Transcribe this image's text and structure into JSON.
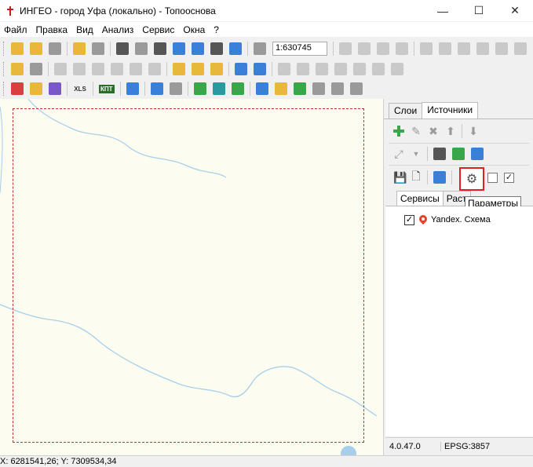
{
  "window": {
    "title": "ИНГЕО - город Уфа (локально) - Топооснова",
    "minimize_glyph": "—",
    "maximize_glyph": "☐",
    "close_glyph": "✕"
  },
  "menu": {
    "items": [
      "Файл",
      "Правка",
      "Вид",
      "Анализ",
      "Сервис",
      "Окна",
      "?"
    ]
  },
  "toolbar": {
    "scale_value": "1:630745",
    "xls_label": "XLS",
    "kpt_label": "КПТ"
  },
  "panel": {
    "tabs": [
      "Слои",
      "Источники"
    ],
    "active_tab": "Источники",
    "subtabs": [
      "Сервисы",
      "Раст"
    ],
    "active_subtab": "Сервисы",
    "tooltip": "Параметры",
    "list": [
      {
        "label": "Yandex. Схема",
        "checked": true
      }
    ],
    "version": "4.0.47.0",
    "epsg": "EPSG:3857"
  },
  "status": {
    "coords": "X: 6281541,26; Y: 7309534,34"
  },
  "colors": {
    "accent_red": "#e02020",
    "map_background": "#fdfcf0",
    "river": "#a8cfea",
    "frame": "#c03030"
  }
}
